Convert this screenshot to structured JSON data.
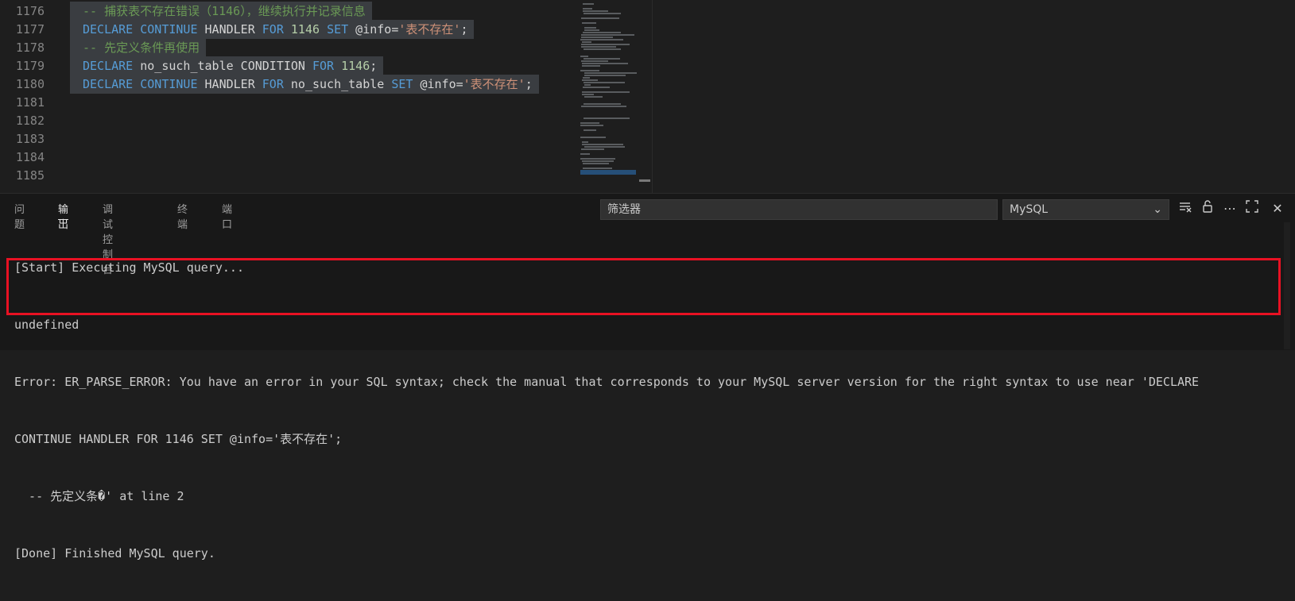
{
  "editor": {
    "lines": [
      {
        "num": "1176",
        "tokens": [
          {
            "t": "-- 捕获表不存在错误（1146），继续执行并记录信息",
            "c": "cm"
          }
        ],
        "selected": true
      },
      {
        "num": "1177",
        "tokens": [
          {
            "t": "DECLARE",
            "c": "kw"
          },
          {
            "t": " ",
            "c": "id"
          },
          {
            "t": "CONTINUE",
            "c": "kw"
          },
          {
            "t": " HANDLER ",
            "c": "id"
          },
          {
            "t": "FOR",
            "c": "kw"
          },
          {
            "t": " ",
            "c": "id"
          },
          {
            "t": "1146",
            "c": "num"
          },
          {
            "t": " ",
            "c": "id"
          },
          {
            "t": "SET",
            "c": "kw"
          },
          {
            "t": " @info=",
            "c": "id"
          },
          {
            "t": "'表不存在'",
            "c": "str"
          },
          {
            "t": ";",
            "c": "id"
          }
        ],
        "selected": true
      },
      {
        "num": "1178",
        "tokens": [
          {
            "t": "-- 先定义条件再使用",
            "c": "cm"
          }
        ],
        "selected": true
      },
      {
        "num": "1179",
        "tokens": [
          {
            "t": "DECLARE",
            "c": "kw"
          },
          {
            "t": " no_such_table CONDITION ",
            "c": "id"
          },
          {
            "t": "FOR",
            "c": "kw"
          },
          {
            "t": " ",
            "c": "id"
          },
          {
            "t": "1146",
            "c": "num"
          },
          {
            "t": ";",
            "c": "id"
          }
        ],
        "selected": true
      },
      {
        "num": "1180",
        "tokens": [
          {
            "t": "DECLARE",
            "c": "kw"
          },
          {
            "t": " ",
            "c": "id"
          },
          {
            "t": "CONTINUE",
            "c": "kw"
          },
          {
            "t": " HANDLER ",
            "c": "id"
          },
          {
            "t": "FOR",
            "c": "kw"
          },
          {
            "t": " no_such_table ",
            "c": "id"
          },
          {
            "t": "SET",
            "c": "kw"
          },
          {
            "t": " @info=",
            "c": "id"
          },
          {
            "t": "'表不存在'",
            "c": "str"
          },
          {
            "t": ";",
            "c": "id"
          }
        ],
        "selected": true
      },
      {
        "num": "1181",
        "tokens": [],
        "selected": false
      },
      {
        "num": "1182",
        "tokens": [],
        "selected": false
      },
      {
        "num": "1183",
        "tokens": [],
        "selected": false
      },
      {
        "num": "1184",
        "tokens": [],
        "selected": false
      },
      {
        "num": "1185",
        "tokens": [],
        "selected": false
      }
    ]
  },
  "panel": {
    "tabs": [
      {
        "label": "问题",
        "active": false
      },
      {
        "label": "输出",
        "active": true
      },
      {
        "label": "调试控制台",
        "active": false
      },
      {
        "label": "终端",
        "active": false
      },
      {
        "label": "端口",
        "active": false
      }
    ],
    "filter_placeholder": "筛选器",
    "channel": "MySQL",
    "icons": [
      "clear-output-icon",
      "lock-icon",
      "more-icon",
      "maximize-icon",
      "close-icon"
    ]
  },
  "output": {
    "lines": [
      "[Start] Executing MySQL query...",
      "undefined",
      "Error: ER_PARSE_ERROR: You have an error in your SQL syntax; check the manual that corresponds to your MySQL server version for the right syntax to use near 'DECLARE",
      "CONTINUE HANDLER FOR 1146 SET @info='表不存在';",
      "  -- 先定义条�' at line 2",
      "[Done] Finished MySQL query."
    ]
  },
  "colors": {
    "keyword": "#569cd6",
    "number": "#b5cea8",
    "string": "#ce9178",
    "comment": "#6a9955",
    "error_box": "#e81123"
  }
}
